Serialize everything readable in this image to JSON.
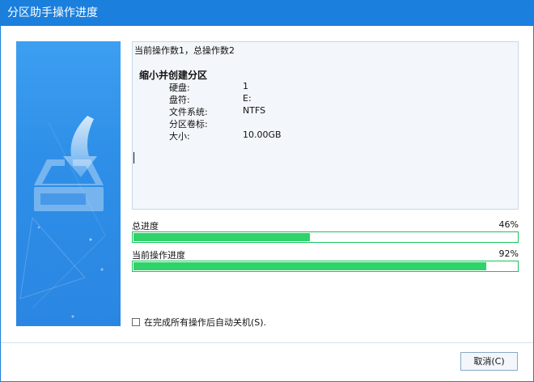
{
  "window": {
    "title": "分区助手操作进度"
  },
  "log": {
    "summary": "当前操作数1，总操作数2",
    "operation_title": "缩小并创建分区",
    "fields": [
      {
        "label": "硬盘:",
        "value": "1"
      },
      {
        "label": "盘符:",
        "value": "E:"
      },
      {
        "label": "文件系统:",
        "value": "NTFS"
      },
      {
        "label": "分区卷标:",
        "value": ""
      },
      {
        "label": "大小:",
        "value": "10.00GB"
      }
    ]
  },
  "progress": {
    "total": {
      "label": "总进度",
      "percent_text": "46%",
      "percent": 46
    },
    "current": {
      "label": "当前操作进度",
      "percent_text": "92%",
      "percent": 92
    }
  },
  "options": {
    "shutdown_label": "在完成所有操作后自动关机(S).",
    "shutdown_checked": false
  },
  "footer": {
    "cancel_label": "取消(C)"
  },
  "colors": {
    "accent": "#1b7fdd",
    "progress_green": "#2fd36a",
    "progress_border": "#19c35d"
  },
  "icons": {
    "banner": "download-tray-icon"
  }
}
